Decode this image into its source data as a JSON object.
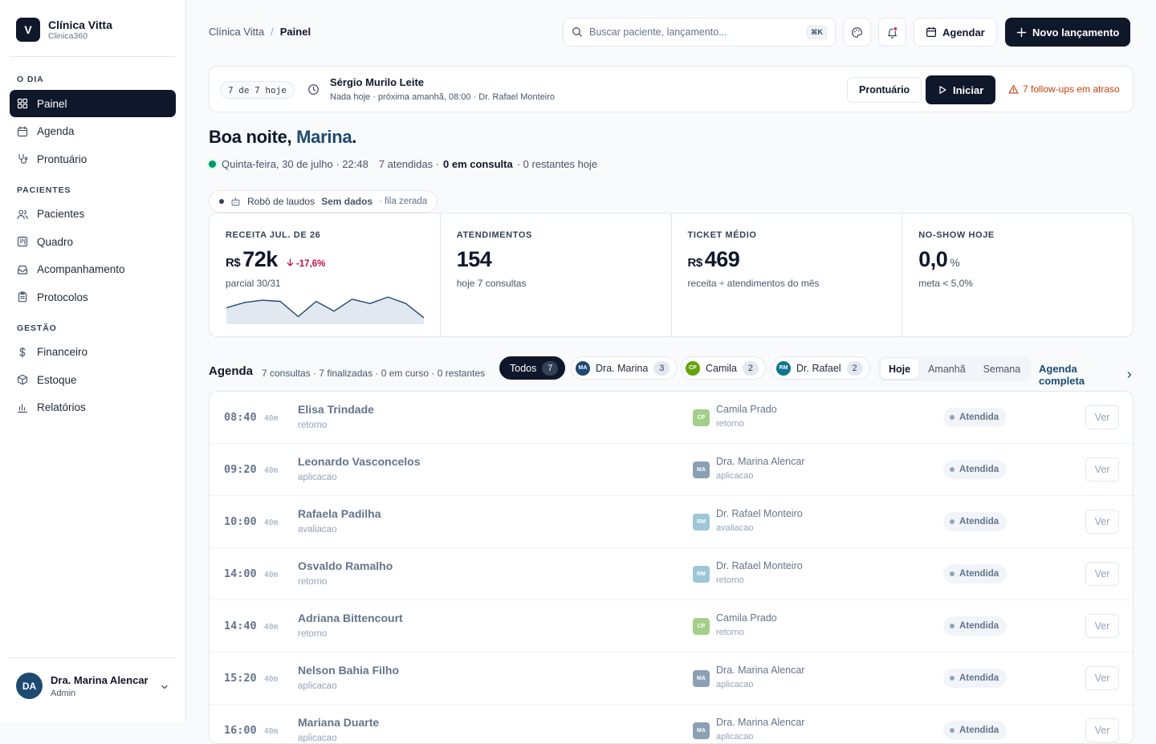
{
  "brand": {
    "logo_letter": "V",
    "name": "Clínica Vitta",
    "sub": "Clinica360"
  },
  "sidebar": {
    "sections": [
      {
        "label": "O DIA",
        "items": [
          {
            "label": "Painel",
            "icon": "grid-icon",
            "active": true
          },
          {
            "label": "Agenda",
            "icon": "calendar-icon"
          },
          {
            "label": "Prontuário",
            "icon": "stethoscope-icon"
          }
        ]
      },
      {
        "label": "PACIENTES",
        "items": [
          {
            "label": "Pacientes",
            "icon": "users-icon"
          },
          {
            "label": "Quadro",
            "icon": "board-icon"
          },
          {
            "label": "Acompanhamento",
            "icon": "inbox-icon"
          },
          {
            "label": "Protocolos",
            "icon": "clipboard-icon"
          }
        ]
      },
      {
        "label": "GESTÃO",
        "items": [
          {
            "label": "Financeiro",
            "icon": "dollar-icon"
          },
          {
            "label": "Estoque",
            "icon": "package-icon"
          },
          {
            "label": "Relatórios",
            "icon": "bar-chart-icon"
          }
        ]
      }
    ],
    "user": {
      "initials": "DA",
      "name": "Dra. Marina Alencar",
      "role": "Admin"
    }
  },
  "header": {
    "breadcrumb": [
      "Clínica Vitta",
      "Painel"
    ],
    "search_placeholder": "Buscar paciente, lançamento...",
    "search_shortcut": "⌘K",
    "agendar_label": "Agendar",
    "novo_label": "Novo lançamento"
  },
  "banner": {
    "count": "7 de 7 hoje",
    "patient": "Sérgio Murilo Leite",
    "sub": "Nada hoje · próxima amanhã, 08:00 · Dr. Rafael Monteiro",
    "prontuario_label": "Prontuário",
    "iniciar_label": "Iniciar",
    "alert": "7 follow-ups em atraso"
  },
  "greeting": {
    "prefix": "Boa noite, ",
    "name": "Marina",
    "suffix": "."
  },
  "status_line": {
    "date": "Quinta-feira, 30 de julho · 22:48",
    "attended": "7 atendidas ·",
    "in_consult": "0 em consulta",
    "remaining": "· 0 restantes hoje"
  },
  "robot": {
    "label": "Robô de laudos",
    "status": "Sem dados",
    "note": "· fila zerada"
  },
  "kpis": [
    {
      "label": "RECEITA JUL. DE 26",
      "currency": "R$",
      "value": "72k",
      "delta": "-17,6%",
      "note": "parcial 30/31"
    },
    {
      "label": "ATENDIMENTOS",
      "value": "154",
      "note": "hoje 7 consultas"
    },
    {
      "label": "TICKET MÉDIO",
      "currency": "R$",
      "value": "469",
      "note": "receita ÷ atendimentos do mês"
    },
    {
      "label": "NO-SHOW HOJE",
      "value": "0,0",
      "unit": "%",
      "note": "meta < 5,0%"
    }
  ],
  "sparkline": {
    "color": "#1e4a72",
    "fill": "#e2e8f0",
    "values": [
      15,
      20,
      22,
      21,
      7,
      21,
      12,
      23,
      19,
      25,
      19,
      6
    ]
  },
  "agenda": {
    "title": "Agenda",
    "meta": "7 consultas · 7 finalizadas · 0 em curso · 0 restantes",
    "filters": [
      {
        "label": "Todos",
        "count": "7",
        "active": true
      },
      {
        "label": "Dra. Marina",
        "count": "3",
        "initials": "MA",
        "color": "#1e4a72"
      },
      {
        "label": "Camila",
        "count": "2",
        "initials": "CP",
        "color": "#65a30d"
      },
      {
        "label": "Dr. Rafael",
        "count": "2",
        "initials": "RM",
        "color": "#0e7490"
      }
    ],
    "ranges": [
      "Hoje",
      "Amanhã",
      "Semana"
    ],
    "link": "Agenda completa",
    "rows": [
      {
        "time": "08:40",
        "dur": "40m",
        "patient": "Elisa Trindade",
        "type": "retorno",
        "initials": "CP",
        "prof": "Camila Prado",
        "color": "#a3cf8a",
        "status": "Atendida",
        "action": "Ver"
      },
      {
        "time": "09:20",
        "dur": "40m",
        "patient": "Leonardo Vasconcelos",
        "type": "aplicacao",
        "initials": "MA",
        "prof": "Dra. Marina Alencar",
        "color": "#8aa0b5",
        "status": "Atendida",
        "action": "Ver"
      },
      {
        "time": "10:00",
        "dur": "40m",
        "patient": "Rafaela Padilha",
        "type": "avaliacao",
        "initials": "RM",
        "prof": "Dr. Rafael Monteiro",
        "color": "#9cc7d6",
        "status": "Atendida",
        "action": "Ver"
      },
      {
        "time": "14:00",
        "dur": "40m",
        "patient": "Osvaldo Ramalho",
        "type": "retorno",
        "initials": "RM",
        "prof": "Dr. Rafael Monteiro",
        "color": "#9cc7d6",
        "status": "Atendida",
        "action": "Ver"
      },
      {
        "time": "14:40",
        "dur": "40m",
        "patient": "Adriana Bittencourt",
        "type": "retorno",
        "initials": "CP",
        "prof": "Camila Prado",
        "color": "#a3cf8a",
        "status": "Atendida",
        "action": "Ver"
      },
      {
        "time": "15:20",
        "dur": "40m",
        "patient": "Nelson Bahia Filho",
        "type": "aplicacao",
        "initials": "MA",
        "prof": "Dra. Marina Alencar",
        "color": "#8aa0b5",
        "status": "Atendida",
        "action": "Ver"
      },
      {
        "time": "16:00",
        "dur": "40m",
        "patient": "Mariana Duarte",
        "type": "aplicacao",
        "initials": "MA",
        "prof": "Dra. Marina Alencar",
        "color": "#8aa0b5",
        "status": "Atendida",
        "action": "Ver"
      }
    ]
  }
}
